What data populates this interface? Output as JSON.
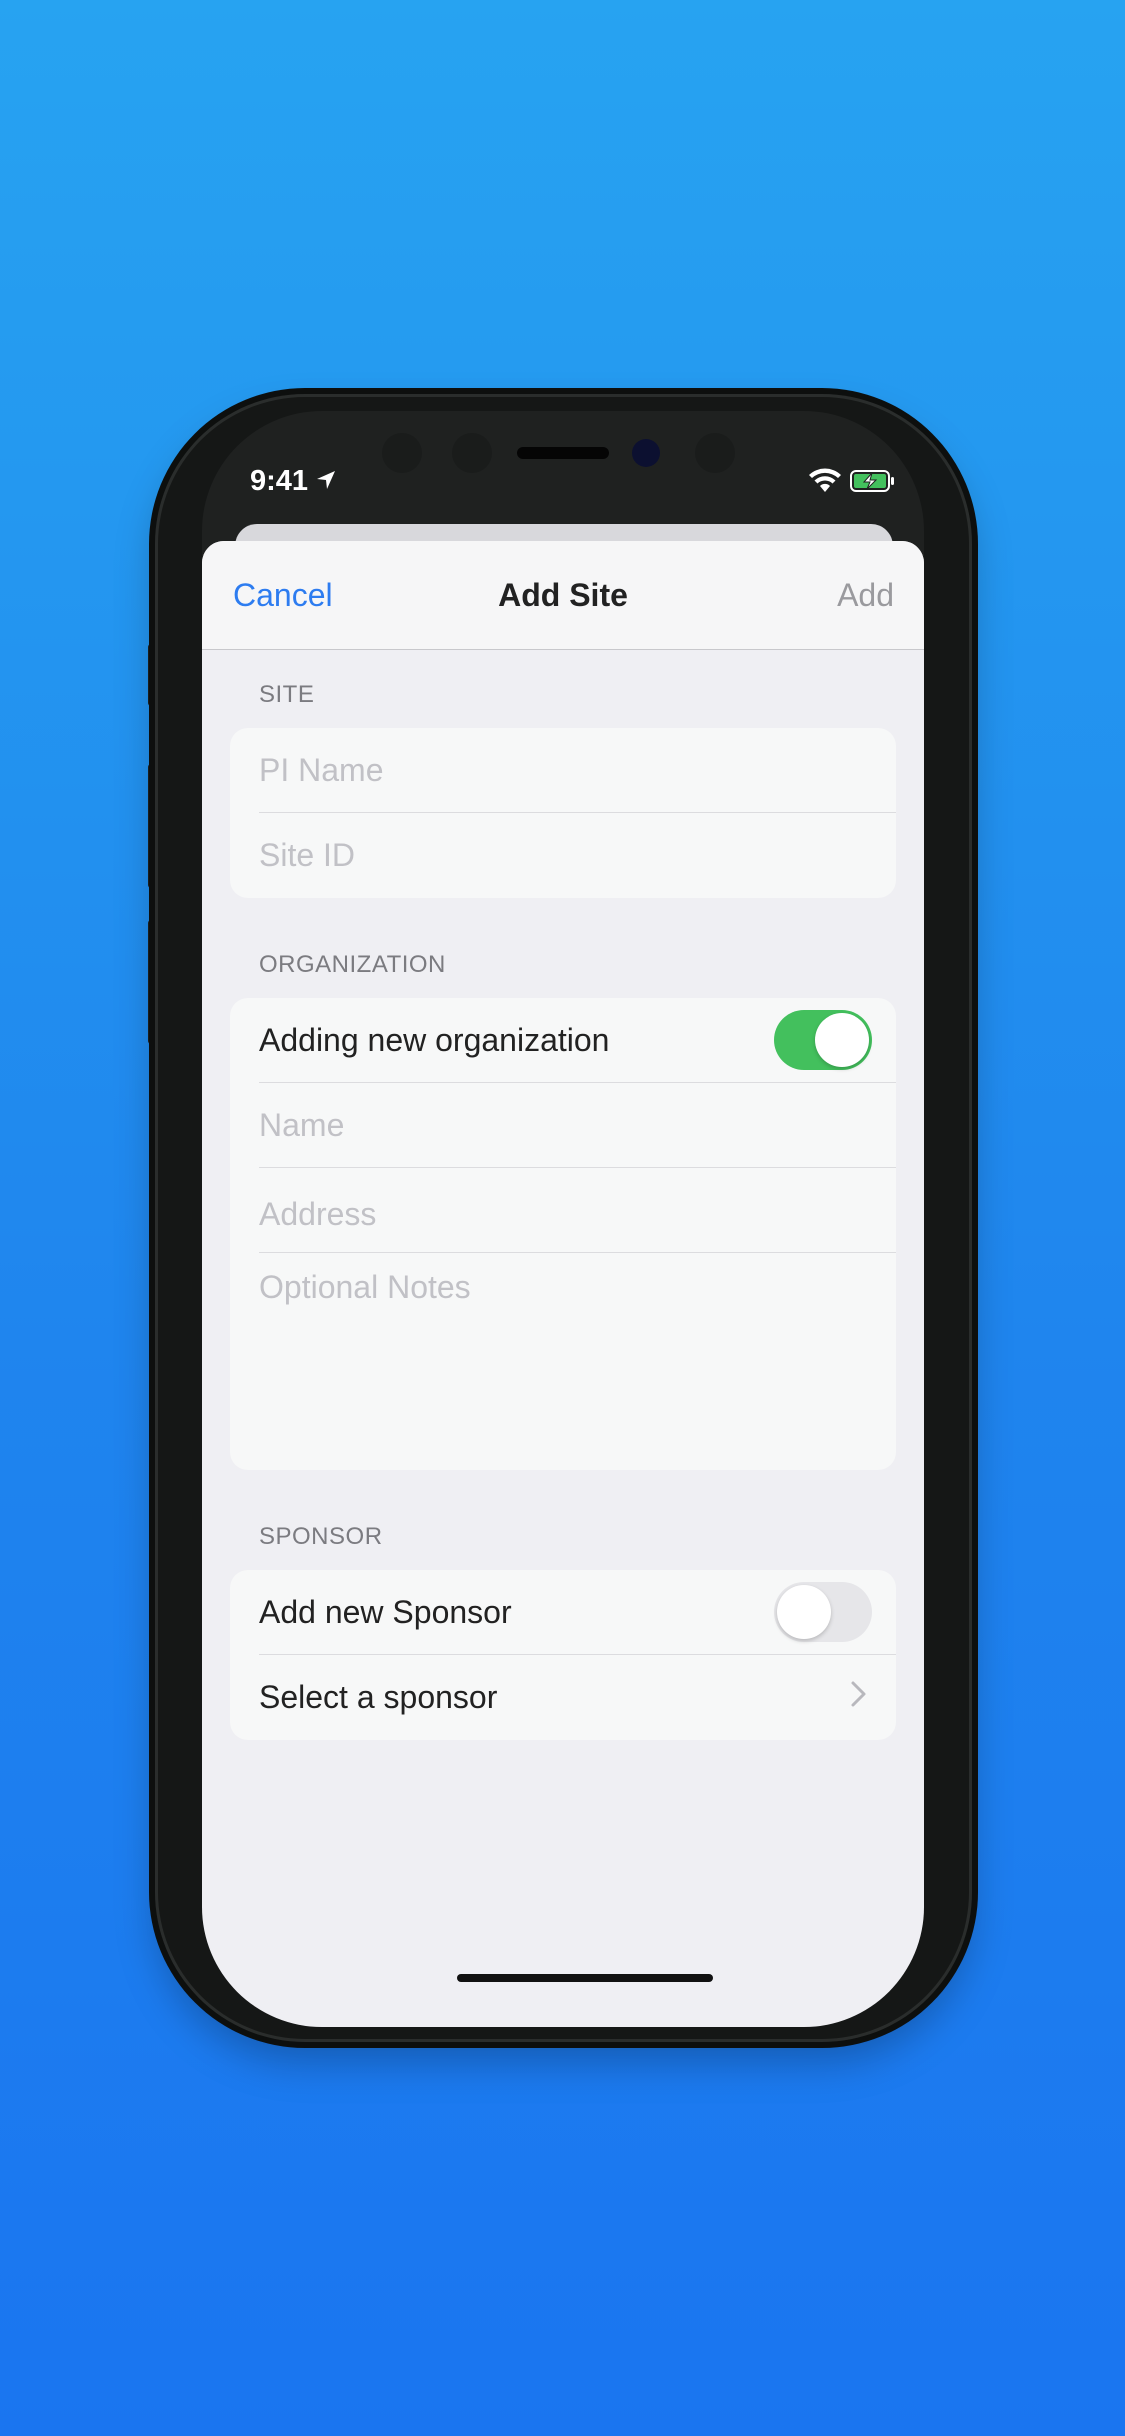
{
  "status": {
    "time": "9:41"
  },
  "nav": {
    "cancel": "Cancel",
    "title": "Add Site",
    "add": "Add"
  },
  "sections": {
    "site": {
      "header": "SITE",
      "pi_name_placeholder": "PI Name",
      "site_id_placeholder": "Site ID"
    },
    "organization": {
      "header": "ORGANIZATION",
      "toggle_label": "Adding new organization",
      "toggle_on": true,
      "name_placeholder": "Name",
      "address_placeholder": "Address",
      "notes_placeholder": "Optional Notes"
    },
    "sponsor": {
      "header": "SPONSOR",
      "toggle_label": "Add new Sponsor",
      "toggle_on": false,
      "select_label": "Select a sponsor"
    }
  },
  "colors": {
    "accent": "#2d7cf0",
    "toggle_on": "#43c05d",
    "background_top": "#27a3f1",
    "background_bottom": "#1a75f0"
  }
}
